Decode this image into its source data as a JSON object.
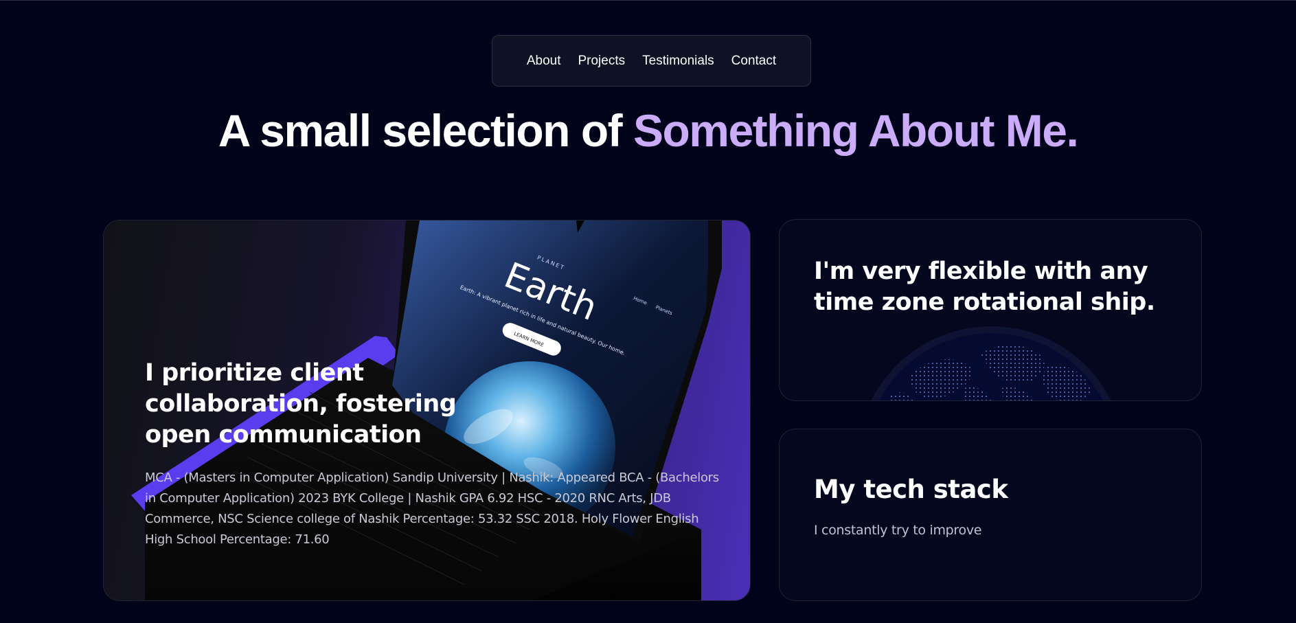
{
  "nav": {
    "items": [
      "About",
      "Projects",
      "Testimonials",
      "Contact"
    ]
  },
  "heading": {
    "prefix": "A small selection of ",
    "accent": "Something About Me."
  },
  "card_main": {
    "title": "I prioritize client collaboration, fostering open communication",
    "description": "MCA - (Masters in Computer Application) Sandip University | Nashik: Appeared BCA - (Bachelors in Computer Application) 2023 BYK College | Nashik GPA 6.92 HSC - 2020 RNC Arts, JDB Commerce, NSC Science college of Nashik Percentage: 53.32 SSC 2018. Holy Flower English High School Percentage: 71.60",
    "illustration": {
      "icon": "laptop-illustration",
      "screen_label": "PLANET",
      "screen_title": "Earth",
      "screen_tagline": "Earth: A vibrant planet rich in life and natural beauty. Our home.",
      "screen_button": "LEARN MORE",
      "screen_nav": [
        "Home",
        "Planets"
      ]
    }
  },
  "card_timezone": {
    "title": "I'm very flexible with any time zone rotational ship.",
    "icon": "globe-icon"
  },
  "card_stack": {
    "title": "My tech stack",
    "subtitle": "I constantly try to improve"
  },
  "colors": {
    "background": "#000319",
    "accent": "#cbacf9",
    "card": "#04071d",
    "purple": "#5b3df0"
  }
}
